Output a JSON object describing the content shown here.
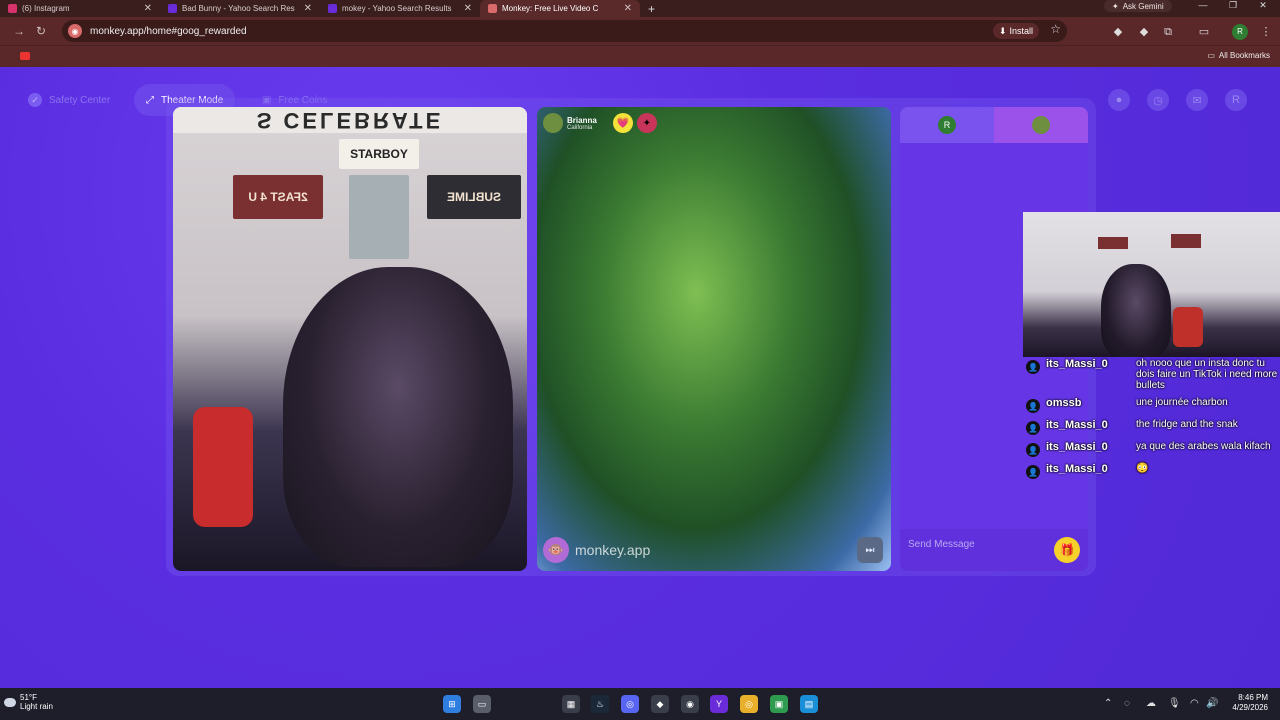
{
  "browser": {
    "tabs": [
      {
        "title": "(6) Instagram",
        "active": false,
        "icon_color": "#d6336c"
      },
      {
        "title": "Bad Bunny - Yahoo Search Res",
        "active": false,
        "icon_color": "#6a2bd9"
      },
      {
        "title": "mokey - Yahoo Search Results",
        "active": false,
        "icon_color": "#6a2bd9"
      },
      {
        "title": "Monkey: Free Live Video C",
        "active": true,
        "icon_color": "#d86a6a"
      }
    ],
    "new_tab": "+",
    "ask_gemini": "Ask Gemini",
    "url": "monkey.app/home#goog_rewarded",
    "install_label": "Install",
    "profile_initial": "R",
    "all_bookmarks": "All Bookmarks"
  },
  "header": {
    "safety_center": "Safety Center",
    "theater_mode": "Theater Mode",
    "free_coins": "Free Coins",
    "profile_initial": "R"
  },
  "peer": {
    "name": "Brianna",
    "location": "California"
  },
  "my_video": {
    "banner": "S CELEBRATE",
    "sign_main": "STARBOY",
    "plate_left": "2FAST 4 U",
    "plate_right": "SUBLIME"
  },
  "watermark": "monkey.app",
  "chat_panel": {
    "self_initial": "R",
    "send_placeholder": "Send Message"
  },
  "stream_chat": [
    {
      "user": "its_Massi_0",
      "text": "oh nooo que un insta donc tu dois faire un TikTok i need more bullets"
    },
    {
      "user": "omssb",
      "text": "une journée charbon"
    },
    {
      "user": "its_Massi_0",
      "text": "the fridge and the snak"
    },
    {
      "user": "its_Massi_0",
      "text": "ya que des arabes wala kifach"
    },
    {
      "user": "its_Massi_0",
      "text": "😳"
    }
  ],
  "taskbar": {
    "temperature": "51°F",
    "weather": "Light rain",
    "time": "8:46 PM",
    "date": "4/29/2026",
    "discord_badge": "99+",
    "store_badge": "10"
  },
  "colors": {
    "brand_purple": "#5b2fd6",
    "browser_frame": "#5a2828",
    "gift_yellow": "#f6d12a"
  }
}
